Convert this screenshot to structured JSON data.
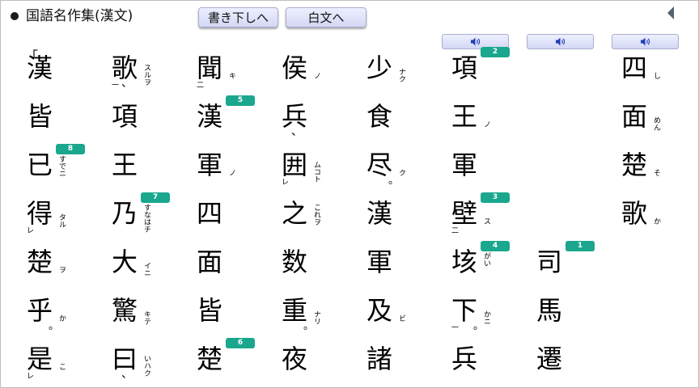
{
  "header": {
    "title": "国語名作集(漢文)",
    "btn_kakikudashi": "書き下しへ",
    "btn_hakubun": "白文へ"
  },
  "icons": {
    "audio": "speaker-icon",
    "collapse": "triangle-left-icon"
  },
  "colors": {
    "badge": "#1aa78e",
    "button_top": "#eef0ff",
    "button_bottom": "#d3d7f3"
  },
  "columns": [
    {
      "id": 1,
      "chars": [
        {
          "c": "漢",
          "mark": "「"
        },
        {
          "c": "皆"
        },
        {
          "c": "已",
          "ruby": "すでニ",
          "badge": "8"
        },
        {
          "c": "得",
          "okuri": "タル",
          "kaeri": "レ"
        },
        {
          "c": "楚",
          "okuri": "ヲ"
        },
        {
          "c": "乎",
          "okuri": "か",
          "maru": true
        },
        {
          "c": "是",
          "okuri": "こ",
          "kaeri": "レ"
        }
      ]
    },
    {
      "id": 2,
      "chars": [
        {
          "c": "歌",
          "okuri": "スルヲ",
          "kaeri": "一",
          "touten": true
        },
        {
          "c": "項"
        },
        {
          "c": "王"
        },
        {
          "c": "乃",
          "ruby": "すなはチ",
          "badge": "7"
        },
        {
          "c": "大",
          "okuri": "イニ"
        },
        {
          "c": "驚",
          "okuri": "キテ"
        },
        {
          "c": "曰",
          "okuri": "いハク",
          "touten": true
        }
      ]
    },
    {
      "id": 3,
      "chars": [
        {
          "c": "聞",
          "okuri": "キ",
          "kaeri": "二"
        },
        {
          "c": "漢",
          "badge": "5"
        },
        {
          "c": "軍",
          "okuri": "ノ"
        },
        {
          "c": "四"
        },
        {
          "c": "面"
        },
        {
          "c": "皆"
        },
        {
          "c": "楚",
          "badge": "6"
        }
      ]
    },
    {
      "id": 4,
      "chars": [
        {
          "c": "侯",
          "okuri": "ノ"
        },
        {
          "c": "兵",
          "touten": true
        },
        {
          "c": "囲",
          "okuri": "ムコト",
          "kaeri": "レ"
        },
        {
          "c": "之",
          "ruby": "これヲ"
        },
        {
          "c": "数"
        },
        {
          "c": "重",
          "okuri": "ナリ",
          "maru": true
        },
        {
          "c": "夜"
        }
      ]
    },
    {
      "id": 5,
      "chars": [
        {
          "c": "少",
          "okuri": "ナク"
        },
        {
          "c": "食"
        },
        {
          "c": "尽",
          "okuri": "ク",
          "maru": true
        },
        {
          "c": "漢"
        },
        {
          "c": "軍"
        },
        {
          "c": "及",
          "okuri": "ビ"
        },
        {
          "c": "諸"
        }
      ]
    },
    {
      "id": 6,
      "chars": [
        {
          "c": "項",
          "badge": "2"
        },
        {
          "c": "王",
          "okuri": "ノ"
        },
        {
          "c": "軍"
        },
        {
          "c": "壁",
          "okuri": "ス",
          "kaeri": "二",
          "badge": "3"
        },
        {
          "c": "垓",
          "ruby": "がい",
          "badge": "4"
        },
        {
          "c": "下",
          "okuri": "かニ",
          "kaeri": "一",
          "maru": true
        },
        {
          "c": "兵"
        }
      ]
    },
    {
      "id": 7,
      "chars": [
        null,
        null,
        null,
        null,
        {
          "c": "司",
          "badge": "1"
        },
        {
          "c": "馬"
        },
        {
          "c": "遷"
        }
      ]
    },
    {
      "id": 8,
      "chars": [
        {
          "c": "四",
          "okuri": "し"
        },
        {
          "c": "面",
          "okuri": "めん"
        },
        {
          "c": "楚",
          "okuri": "そ"
        },
        {
          "c": "歌",
          "okuri": "か"
        },
        null,
        null,
        null
      ]
    }
  ]
}
